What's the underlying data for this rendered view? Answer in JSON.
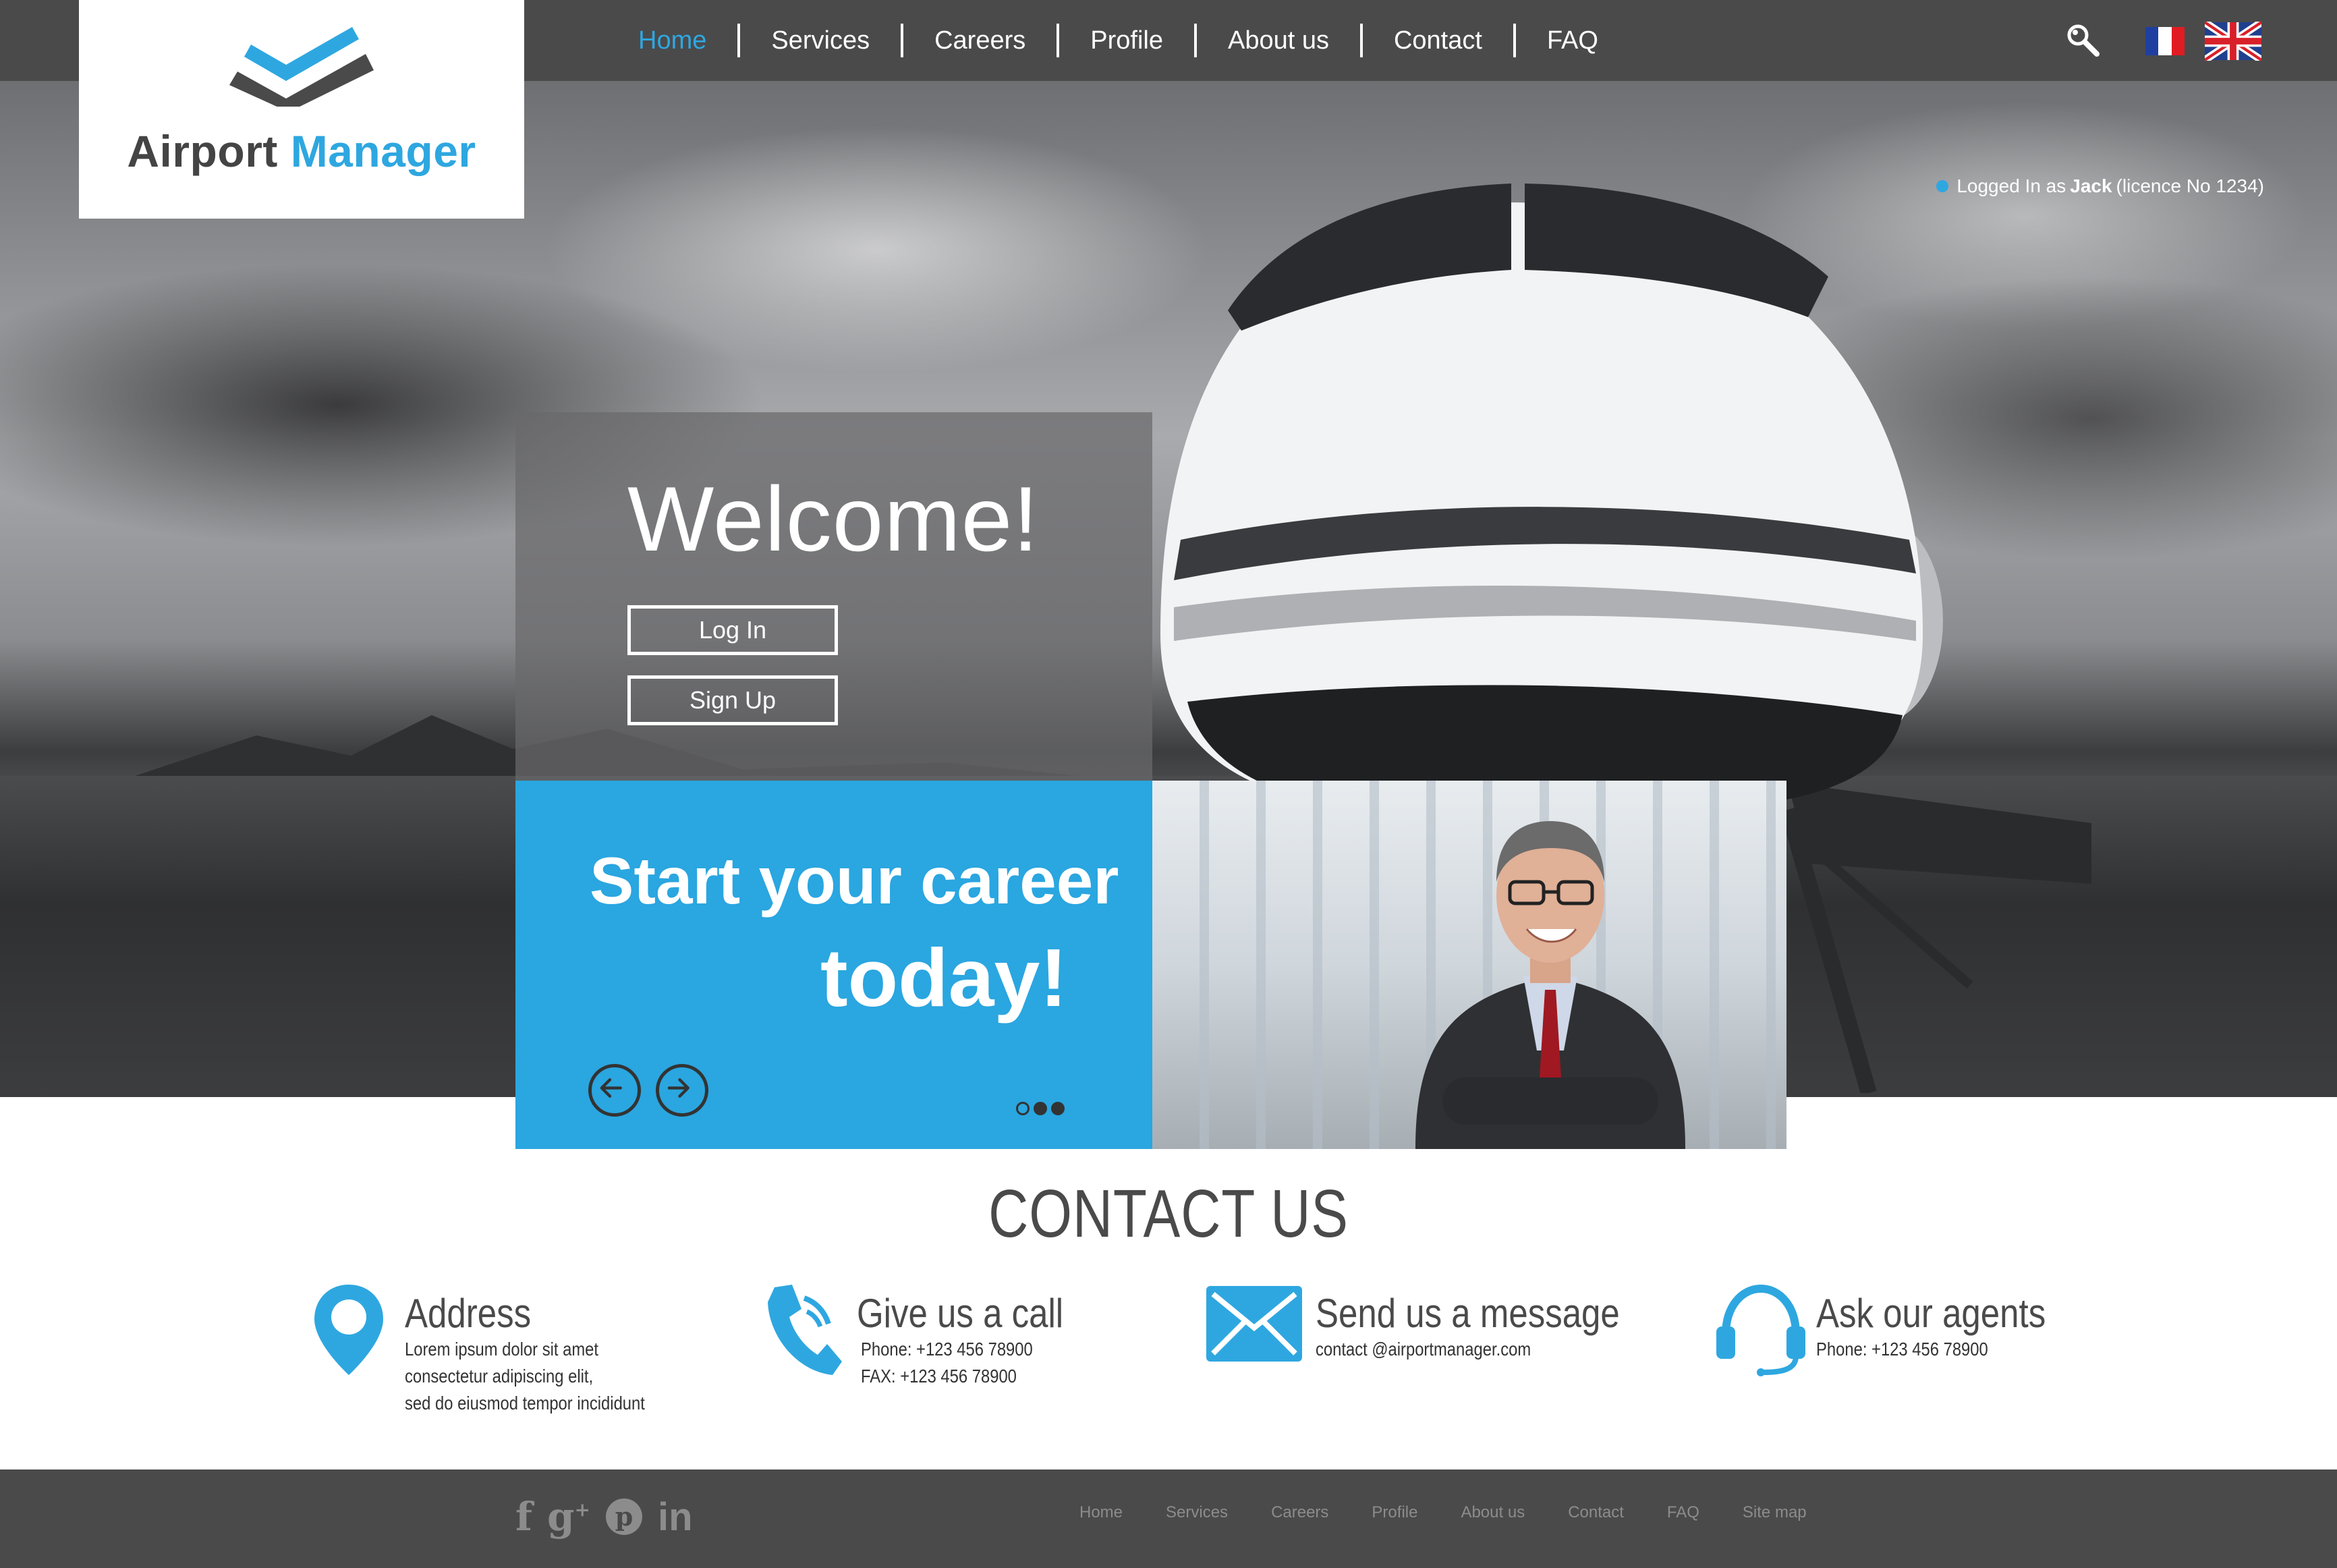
{
  "brand": {
    "name_part1": "Airport",
    "name_part2": "Manager",
    "accent": "#2ea7e0"
  },
  "nav": {
    "items": [
      {
        "label": "Home",
        "active": true
      },
      {
        "label": "Services"
      },
      {
        "label": "Careers"
      },
      {
        "label": "Profile"
      },
      {
        "label": "About us"
      },
      {
        "label": "Contact"
      },
      {
        "label": "FAQ"
      }
    ],
    "icons": [
      "search-icon",
      "flag-france-icon",
      "flag-uk-icon"
    ]
  },
  "status": {
    "prefix": "Logged In as",
    "user": "Jack",
    "suffix": "(licence No 1234)"
  },
  "welcome": {
    "title": "Welcome!",
    "login_label": "Log In",
    "signup_label": "Sign Up"
  },
  "career": {
    "line1": "Start your career",
    "line2": "today!",
    "slides_total": 3,
    "slide_active": 2
  },
  "contact": {
    "title": "CONTACT US",
    "blocks": [
      {
        "icon": "map-pin-icon",
        "heading": "Address",
        "lines": [
          "Lorem ipsum dolor sit amet",
          "consectetur adipiscing elit,",
          "sed do eiusmod tempor incididunt"
        ]
      },
      {
        "icon": "phone-icon",
        "heading": "Give us a call",
        "lines": [
          "Phone: +123 456 78900",
          "FAX: +123 456 78900"
        ]
      },
      {
        "icon": "envelope-icon",
        "heading": "Send us a message",
        "lines": [
          "contact @airportmanager.com"
        ]
      },
      {
        "icon": "headset-icon",
        "heading": "Ask our agents",
        "lines": [
          "Phone: +123 456 78900"
        ]
      }
    ]
  },
  "footer": {
    "social": [
      "facebook-icon",
      "google-plus-icon",
      "pinterest-icon",
      "linkedin-icon"
    ],
    "links": [
      "Home",
      "Services",
      "Careers",
      "Profile",
      "About us",
      "Contact",
      "FAQ",
      "Site map"
    ]
  }
}
